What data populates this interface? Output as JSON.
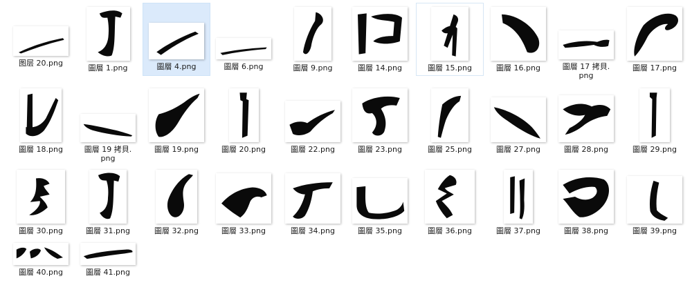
{
  "window": {
    "view": "large-icons"
  },
  "files": [
    {
      "name": "图层 20.png",
      "icon": "brush-stroke-thumbnail"
    },
    {
      "name": "圖層 1.png",
      "icon": "brush-stroke-thumbnail"
    },
    {
      "name": "圖層 4.png",
      "icon": "brush-stroke-thumbnail",
      "selected": true
    },
    {
      "name": "圖層 6.png",
      "icon": "brush-stroke-thumbnail"
    },
    {
      "name": "圖層 9.png",
      "icon": "brush-stroke-thumbnail"
    },
    {
      "name": "圖層 14.png",
      "icon": "brush-stroke-thumbnail"
    },
    {
      "name": "圖層 15.png",
      "icon": "brush-stroke-thumbnail",
      "hovered": true
    },
    {
      "name": "圖層 16.png",
      "icon": "brush-stroke-thumbnail"
    },
    {
      "name": "圖層 17 拷貝.\npng",
      "icon": "brush-stroke-thumbnail"
    },
    {
      "name": "圖層 17.png",
      "icon": "brush-stroke-thumbnail"
    },
    {
      "name": "圖層 18.png",
      "icon": "brush-stroke-thumbnail"
    },
    {
      "name": "圖層 19 拷貝.\npng",
      "icon": "brush-stroke-thumbnail"
    },
    {
      "name": "圖層 19.png",
      "icon": "brush-stroke-thumbnail"
    },
    {
      "name": "圖層 20.png",
      "icon": "brush-stroke-thumbnail"
    },
    {
      "name": "圖層 22.png",
      "icon": "brush-stroke-thumbnail"
    },
    {
      "name": "圖層 23.png",
      "icon": "brush-stroke-thumbnail"
    },
    {
      "name": "圖層 25.png",
      "icon": "brush-stroke-thumbnail"
    },
    {
      "name": "圖層 27.png",
      "icon": "brush-stroke-thumbnail"
    },
    {
      "name": "圖層 28.png",
      "icon": "brush-stroke-thumbnail"
    },
    {
      "name": "圖層 29.png",
      "icon": "brush-stroke-thumbnail"
    },
    {
      "name": "圖層 30.png",
      "icon": "brush-stroke-thumbnail"
    },
    {
      "name": "圖層 31.png",
      "icon": "brush-stroke-thumbnail"
    },
    {
      "name": "圖層 32.png",
      "icon": "brush-stroke-thumbnail"
    },
    {
      "name": "圖層 33.png",
      "icon": "brush-stroke-thumbnail"
    },
    {
      "name": "圖層 34.png",
      "icon": "brush-stroke-thumbnail"
    },
    {
      "name": "圖層 35.png",
      "icon": "brush-stroke-thumbnail"
    },
    {
      "name": "圖層 36.png",
      "icon": "brush-stroke-thumbnail"
    },
    {
      "name": "圖層 37.png",
      "icon": "brush-stroke-thumbnail"
    },
    {
      "name": "圖層 38.png",
      "icon": "brush-stroke-thumbnail"
    },
    {
      "name": "圖層 39.png",
      "icon": "brush-stroke-thumbnail"
    },
    {
      "name": "圖層 40.png",
      "icon": "brush-stroke-thumbnail"
    },
    {
      "name": "圖層 41.png",
      "icon": "brush-stroke-thumbnail"
    }
  ]
}
